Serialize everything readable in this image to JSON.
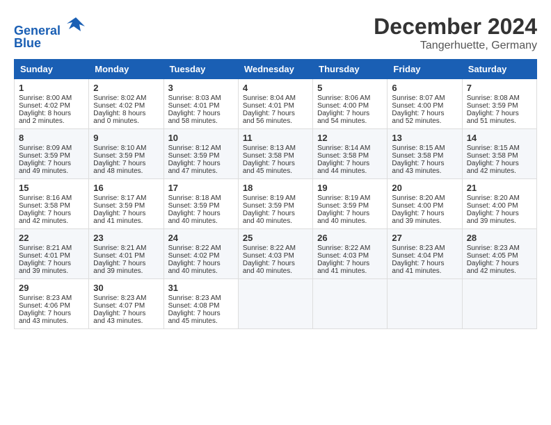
{
  "header": {
    "logo_line1": "General",
    "logo_line2": "Blue",
    "month_title": "December 2024",
    "location": "Tangerhuette, Germany"
  },
  "weekdays": [
    "Sunday",
    "Monday",
    "Tuesday",
    "Wednesday",
    "Thursday",
    "Friday",
    "Saturday"
  ],
  "weeks": [
    [
      {
        "day": "1",
        "lines": [
          "Sunrise: 8:00 AM",
          "Sunset: 4:02 PM",
          "Daylight: 8 hours",
          "and 2 minutes."
        ]
      },
      {
        "day": "2",
        "lines": [
          "Sunrise: 8:02 AM",
          "Sunset: 4:02 PM",
          "Daylight: 8 hours",
          "and 0 minutes."
        ]
      },
      {
        "day": "3",
        "lines": [
          "Sunrise: 8:03 AM",
          "Sunset: 4:01 PM",
          "Daylight: 7 hours",
          "and 58 minutes."
        ]
      },
      {
        "day": "4",
        "lines": [
          "Sunrise: 8:04 AM",
          "Sunset: 4:01 PM",
          "Daylight: 7 hours",
          "and 56 minutes."
        ]
      },
      {
        "day": "5",
        "lines": [
          "Sunrise: 8:06 AM",
          "Sunset: 4:00 PM",
          "Daylight: 7 hours",
          "and 54 minutes."
        ]
      },
      {
        "day": "6",
        "lines": [
          "Sunrise: 8:07 AM",
          "Sunset: 4:00 PM",
          "Daylight: 7 hours",
          "and 52 minutes."
        ]
      },
      {
        "day": "7",
        "lines": [
          "Sunrise: 8:08 AM",
          "Sunset: 3:59 PM",
          "Daylight: 7 hours",
          "and 51 minutes."
        ]
      }
    ],
    [
      {
        "day": "8",
        "lines": [
          "Sunrise: 8:09 AM",
          "Sunset: 3:59 PM",
          "Daylight: 7 hours",
          "and 49 minutes."
        ]
      },
      {
        "day": "9",
        "lines": [
          "Sunrise: 8:10 AM",
          "Sunset: 3:59 PM",
          "Daylight: 7 hours",
          "and 48 minutes."
        ]
      },
      {
        "day": "10",
        "lines": [
          "Sunrise: 8:12 AM",
          "Sunset: 3:59 PM",
          "Daylight: 7 hours",
          "and 47 minutes."
        ]
      },
      {
        "day": "11",
        "lines": [
          "Sunrise: 8:13 AM",
          "Sunset: 3:58 PM",
          "Daylight: 7 hours",
          "and 45 minutes."
        ]
      },
      {
        "day": "12",
        "lines": [
          "Sunrise: 8:14 AM",
          "Sunset: 3:58 PM",
          "Daylight: 7 hours",
          "and 44 minutes."
        ]
      },
      {
        "day": "13",
        "lines": [
          "Sunrise: 8:15 AM",
          "Sunset: 3:58 PM",
          "Daylight: 7 hours",
          "and 43 minutes."
        ]
      },
      {
        "day": "14",
        "lines": [
          "Sunrise: 8:15 AM",
          "Sunset: 3:58 PM",
          "Daylight: 7 hours",
          "and 42 minutes."
        ]
      }
    ],
    [
      {
        "day": "15",
        "lines": [
          "Sunrise: 8:16 AM",
          "Sunset: 3:58 PM",
          "Daylight: 7 hours",
          "and 42 minutes."
        ]
      },
      {
        "day": "16",
        "lines": [
          "Sunrise: 8:17 AM",
          "Sunset: 3:59 PM",
          "Daylight: 7 hours",
          "and 41 minutes."
        ]
      },
      {
        "day": "17",
        "lines": [
          "Sunrise: 8:18 AM",
          "Sunset: 3:59 PM",
          "Daylight: 7 hours",
          "and 40 minutes."
        ]
      },
      {
        "day": "18",
        "lines": [
          "Sunrise: 8:19 AM",
          "Sunset: 3:59 PM",
          "Daylight: 7 hours",
          "and 40 minutes."
        ]
      },
      {
        "day": "19",
        "lines": [
          "Sunrise: 8:19 AM",
          "Sunset: 3:59 PM",
          "Daylight: 7 hours",
          "and 40 minutes."
        ]
      },
      {
        "day": "20",
        "lines": [
          "Sunrise: 8:20 AM",
          "Sunset: 4:00 PM",
          "Daylight: 7 hours",
          "and 39 minutes."
        ]
      },
      {
        "day": "21",
        "lines": [
          "Sunrise: 8:20 AM",
          "Sunset: 4:00 PM",
          "Daylight: 7 hours",
          "and 39 minutes."
        ]
      }
    ],
    [
      {
        "day": "22",
        "lines": [
          "Sunrise: 8:21 AM",
          "Sunset: 4:01 PM",
          "Daylight: 7 hours",
          "and 39 minutes."
        ]
      },
      {
        "day": "23",
        "lines": [
          "Sunrise: 8:21 AM",
          "Sunset: 4:01 PM",
          "Daylight: 7 hours",
          "and 39 minutes."
        ]
      },
      {
        "day": "24",
        "lines": [
          "Sunrise: 8:22 AM",
          "Sunset: 4:02 PM",
          "Daylight: 7 hours",
          "and 40 minutes."
        ]
      },
      {
        "day": "25",
        "lines": [
          "Sunrise: 8:22 AM",
          "Sunset: 4:03 PM",
          "Daylight: 7 hours",
          "and 40 minutes."
        ]
      },
      {
        "day": "26",
        "lines": [
          "Sunrise: 8:22 AM",
          "Sunset: 4:03 PM",
          "Daylight: 7 hours",
          "and 41 minutes."
        ]
      },
      {
        "day": "27",
        "lines": [
          "Sunrise: 8:23 AM",
          "Sunset: 4:04 PM",
          "Daylight: 7 hours",
          "and 41 minutes."
        ]
      },
      {
        "day": "28",
        "lines": [
          "Sunrise: 8:23 AM",
          "Sunset: 4:05 PM",
          "Daylight: 7 hours",
          "and 42 minutes."
        ]
      }
    ],
    [
      {
        "day": "29",
        "lines": [
          "Sunrise: 8:23 AM",
          "Sunset: 4:06 PM",
          "Daylight: 7 hours",
          "and 43 minutes."
        ]
      },
      {
        "day": "30",
        "lines": [
          "Sunrise: 8:23 AM",
          "Sunset: 4:07 PM",
          "Daylight: 7 hours",
          "and 43 minutes."
        ]
      },
      {
        "day": "31",
        "lines": [
          "Sunrise: 8:23 AM",
          "Sunset: 4:08 PM",
          "Daylight: 7 hours",
          "and 45 minutes."
        ]
      },
      null,
      null,
      null,
      null
    ]
  ]
}
